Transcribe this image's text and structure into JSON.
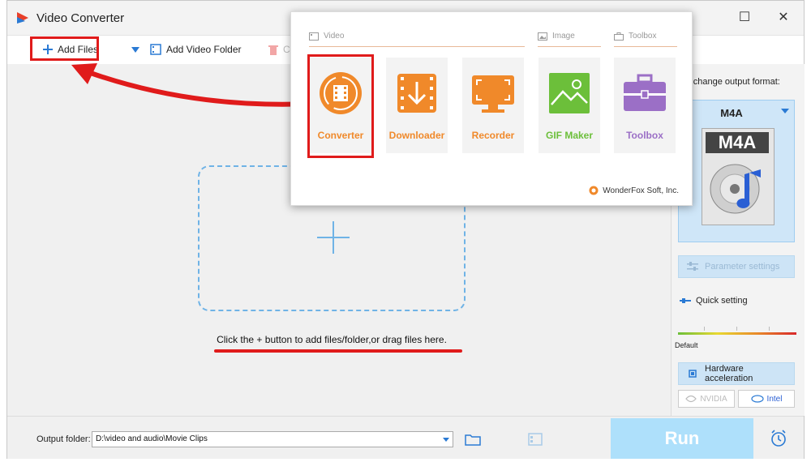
{
  "app": {
    "title": "Video Converter"
  },
  "window_controls": {
    "maximize": "☐",
    "close": "✕"
  },
  "toolbar": {
    "add_files": "Add Files",
    "add_video_folder": "Add Video Folder",
    "clear_partial": "C"
  },
  "main": {
    "hint": "Click the + button to add files/folder,or drag files here."
  },
  "right_panel": {
    "hint": "k to change output format:",
    "format": "M4A",
    "format_icon_label": "M4A",
    "parameter_settings": "Parameter settings",
    "quick_setting": "Quick setting",
    "default_label": "Default",
    "hardware_acceleration": "Hardware acceleration",
    "nvidia": "NVIDIA",
    "intel": "Intel"
  },
  "bottom": {
    "output_folder_label": "Output folder:",
    "output_folder_value": "D:\\video and audio\\Movie Clips",
    "run": "Run"
  },
  "popup": {
    "sections": {
      "video": "Video",
      "image": "Image",
      "toolbox": "Toolbox"
    },
    "tiles": [
      {
        "label": "Converter",
        "color": "#f0892a"
      },
      {
        "label": "Downloader",
        "color": "#f0892a"
      },
      {
        "label": "Recorder",
        "color": "#f0892a"
      },
      {
        "label": "GIF Maker",
        "color": "#6cbf3a"
      },
      {
        "label": "Toolbox",
        "color": "#9b6fc6"
      }
    ],
    "brand": "WonderFox Soft, Inc."
  },
  "colors": {
    "accent_blue": "#2a7ad4",
    "highlight_red": "#e01b1b",
    "run_disabled": "#aee0fb"
  }
}
